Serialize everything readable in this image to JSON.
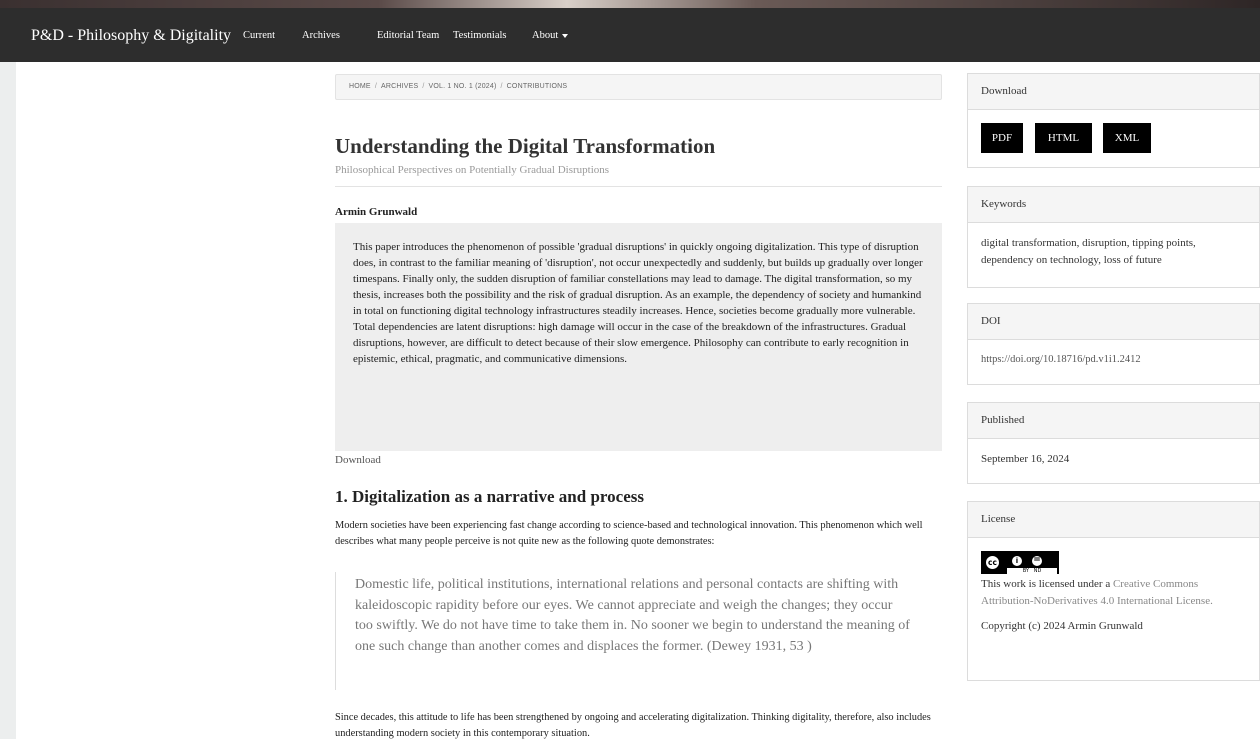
{
  "nav": {
    "brand": "P&D - Philosophy & Digitality",
    "items": [
      {
        "label": "Current"
      },
      {
        "label": "Archives"
      },
      {
        "label": "Editorial Team"
      },
      {
        "label": "Testimonials"
      },
      {
        "label": "About"
      }
    ]
  },
  "breadcrumb": [
    "HOME",
    "ARCHIVES",
    "VOL. 1 NO. 1 (2024)",
    "CONTRIBUTIONS"
  ],
  "article": {
    "title": "Understanding the Digital Transformation",
    "subtitle": "Philosophical Perspectives on Potentially Gradual Disruptions",
    "author": "Armin Grunwald",
    "abstract": "This paper introduces the phenomenon of possible 'gradual disruptions' in quickly ongoing digitalization. This type of disruption does, in contrast to the familiar meaning of 'disruption', not occur unexpectedly and suddenly, but builds up gradually over longer timespans. Finally only, the sudden disruption of familiar constellations may lead to damage. The digital transformation, so my thesis, increases both the possibility and the risk of gradual disruption. As an example, the dependency of society and humankind in total on functioning digital technology infrastructures steadily increases. Hence, societies become gradually more vulnerable. Total dependencies are latent disruptions: high damage will occur in the case of the breakdown of the infrastructures. Gradual disruptions, however, are difficult to detect because of their slow emergence. Philosophy can contribute to early recognition in epistemic, ethical, pragmatic, and communicative dimensions.",
    "download_link": "Download",
    "section_heading": "1. Digitalization as a narrative and process",
    "para1": "Modern societies have been experiencing fast change according to science-based and technological innovation. This phenomenon which well describes what many people perceive is not quite new as the following quote demonstrates:",
    "quote": "Domestic life, political institutions, international relations and personal contacts are shifting with kaleidoscopic rapidity before our eyes. We cannot appreciate and weigh the changes; they occur too swiftly. We do not have time to take them in. No sooner we begin to understand the meaning of one such change than another comes and displaces the former. (Dewey 1931, 53 )",
    "para2": "Since decades, this attitude to life has been strengthened by ongoing and accelerating digitalization. Thinking digitality, therefore, also includes understanding modern society in this contemporary situation."
  },
  "sidebar": {
    "download": {
      "title": "Download",
      "buttons": [
        "PDF",
        "HTML",
        "XML"
      ]
    },
    "keywords": {
      "title": "Keywords",
      "text": "digital transformation, disruption, tipping points, dependency on technology, loss of future"
    },
    "doi": {
      "title": "DOI",
      "text": "https://doi.org/10.18716/pd.v1i1.2412"
    },
    "published": {
      "title": "Published",
      "text": "September 16, 2024"
    },
    "license": {
      "title": "License",
      "badge": {
        "cc": "cc",
        "by": "BY",
        "nd": "ND"
      },
      "text_prefix": "This work is licensed under a",
      "link_text": "Creative Commons Attribution-NoDerivatives 4.0 International License.",
      "copyright": "Copyright (c) 2024 Armin Grunwald"
    }
  }
}
